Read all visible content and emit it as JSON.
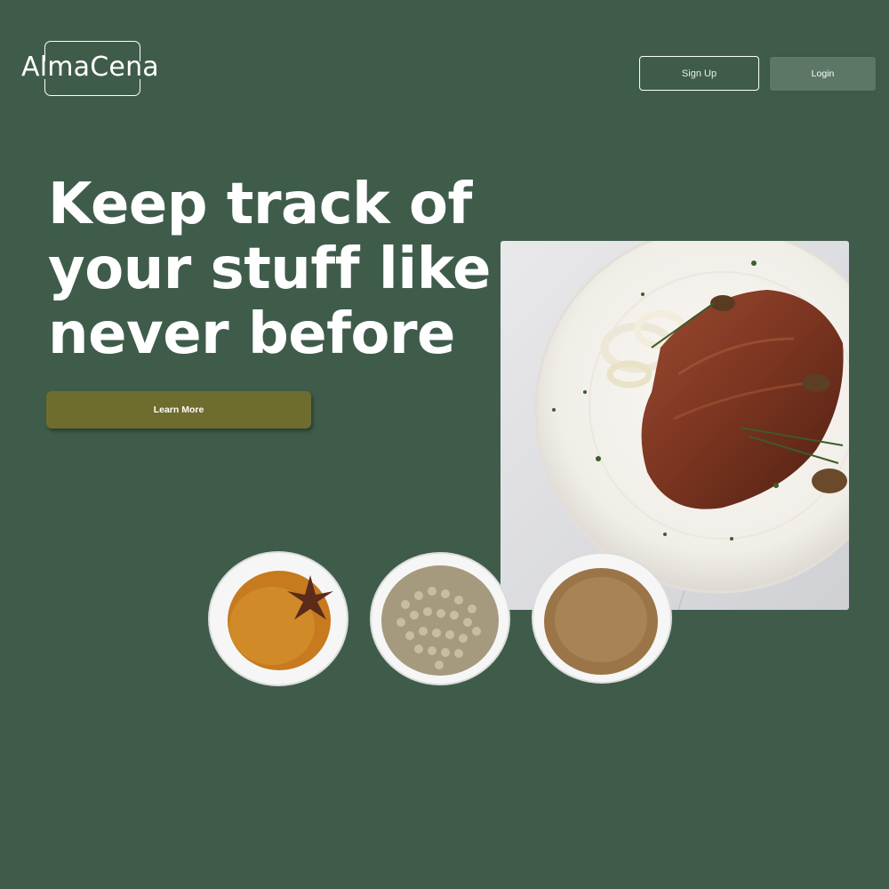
{
  "brand": {
    "logo_text": "AlmaCena"
  },
  "header": {
    "signup_label": "Sign Up",
    "login_label": "Login"
  },
  "hero": {
    "line1": "Keep track of",
    "line2": "your stuff like",
    "line3": "never before",
    "cta_label": "Learn More"
  },
  "colors": {
    "background": "#3f5c4b",
    "cta": "#6e6d2d",
    "login_button": "#5d7767",
    "text": "#ffffff"
  },
  "images": {
    "main_photo": "steak-dinner-plate-image",
    "bowls": [
      "turmeric-star-anise-bowl-image",
      "white-peppercorn-bowl-image",
      "ground-spice-bowl-image"
    ]
  }
}
